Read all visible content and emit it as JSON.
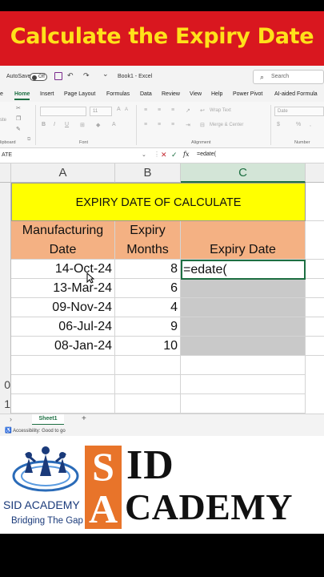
{
  "banner": {
    "title": "Calculate the Expiry Date"
  },
  "titlebar": {
    "autosave_label": "AutoSave",
    "autosave_state": "Off",
    "undo_glyph": "↶",
    "redo_glyph": "↷",
    "more_glyph": "⌄",
    "workbook_title": "Book1 - Excel",
    "search_placeholder": "Search"
  },
  "ribbon_tabs": [
    "e",
    "Home",
    "Insert",
    "Page Layout",
    "Formulas",
    "Data",
    "Review",
    "View",
    "Help",
    "Power Pivot",
    "AI-aided Formula"
  ],
  "ribbon": {
    "clipboard_label": "lipboard",
    "font_label": "Font",
    "alignment_label": "Alignment",
    "number_label": "Number",
    "wrap_text_label": "Wrap Text",
    "merge_center_label": "Merge & Center",
    "number_format": "Date",
    "font_size": "11",
    "bold": "B",
    "italic": "I",
    "underline": "U",
    "paste_label": "ste"
  },
  "formula_bar": {
    "name_box": "ATE",
    "cancel_glyph": "✕",
    "enter_glyph": "✓",
    "fx_label": "fx",
    "content": "=edate("
  },
  "columns": [
    "A",
    "B",
    "C"
  ],
  "row_numbers": [
    "",
    "",
    "",
    "",
    "",
    "",
    "",
    "",
    "",
    "",
    "0",
    "1"
  ],
  "table": {
    "title": "EXPIRY DATE OF CALCULATE",
    "headers": {
      "manufacturing_line1": "Manufacturing",
      "manufacturing_line2": "Date",
      "expiry_months_line1": "Expiry",
      "expiry_months_line2": "Months",
      "expiry_date": "Expiry Date"
    },
    "rows": [
      {
        "date": "14-Oct-24",
        "months": "8",
        "expiry": "=edate("
      },
      {
        "date": "13-Mar-24",
        "months": "6",
        "expiry": ""
      },
      {
        "date": "09-Nov-24",
        "months": "4",
        "expiry": ""
      },
      {
        "date": "06-Jul-24",
        "months": "9",
        "expiry": ""
      },
      {
        "date": "08-Jan-24",
        "months": "10",
        "expiry": ""
      }
    ]
  },
  "sheet_tabs": {
    "prev_glyph": "›",
    "active": "Sheet1",
    "add_glyph": "+"
  },
  "status": {
    "accessibility": "Accessibility: Good to go"
  },
  "branding": {
    "logo_name": "SID ACADEMY",
    "tagline": "Bridging The Gap",
    "big_s": "S",
    "big_id": "ID",
    "big_a": "A",
    "big_cademy": "CADEMY",
    "orange": "#e8742a",
    "navy": "#1a3a7a"
  },
  "colors": {
    "banner_red": "#d9171f",
    "banner_text": "#ffe11a",
    "excel_green": "#1d6f42",
    "title_yellow": "#ffff00",
    "header_orange": "#f4b183"
  }
}
